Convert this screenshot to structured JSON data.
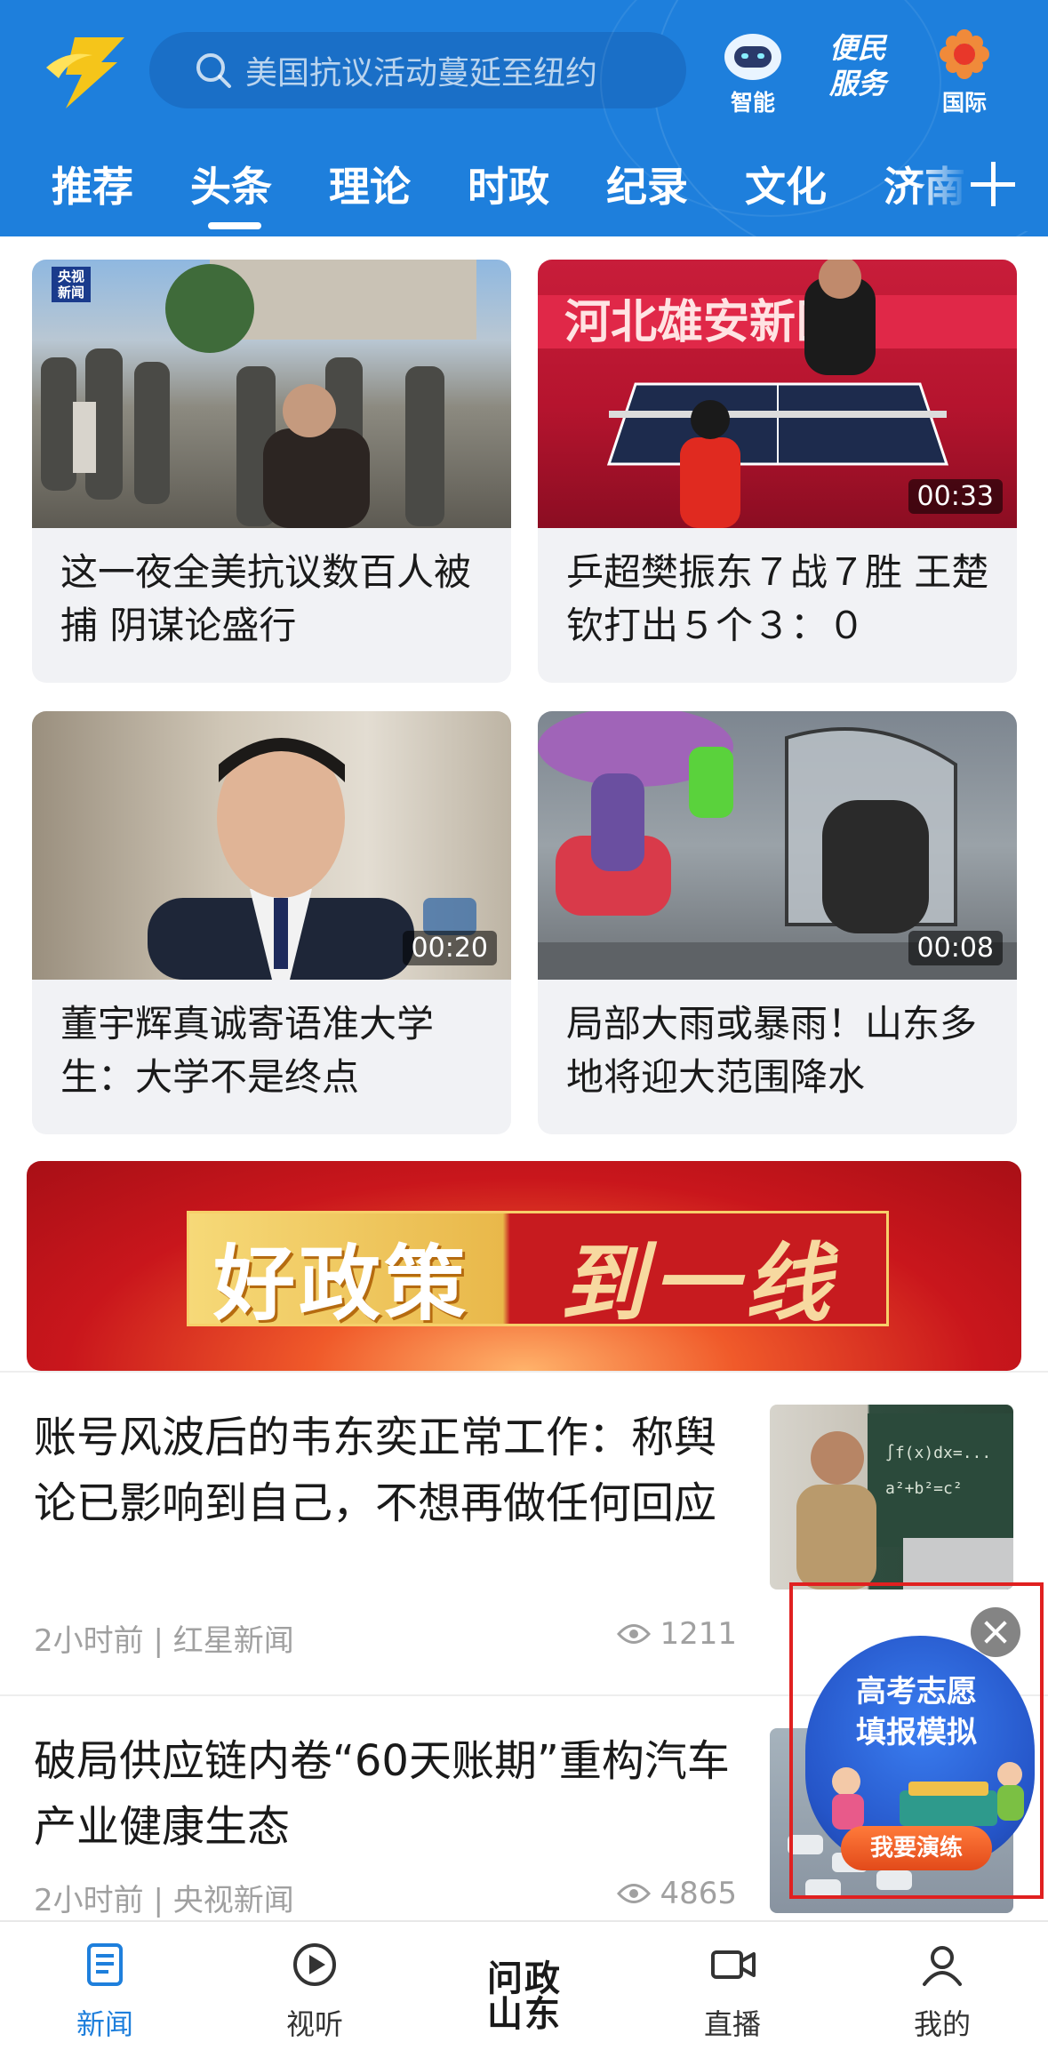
{
  "header": {
    "search_placeholder": "美国抗议活动蔓延至纽约",
    "icons": [
      {
        "name": "smart-icon",
        "label": "智能"
      },
      {
        "name": "service-icon",
        "label": "便民服务"
      },
      {
        "name": "intl-icon",
        "label": "国际"
      }
    ],
    "service_logo_text": "便民服务"
  },
  "tabs": [
    "推荐",
    "头条",
    "理论",
    "时政",
    "纪录",
    "文化",
    "济南"
  ],
  "active_tab": "头条",
  "cards": [
    {
      "title": "这一夜全美抗议数百人被捕 阴谋论盛行",
      "badge": "央视新闻",
      "duration": ""
    },
    {
      "title": "乒超樊振东７战７胜 王楚钦打出５个３：０",
      "badge": "",
      "duration": "00:33"
    },
    {
      "title": "董宇辉真诚寄语准大学生：大学不是终点",
      "badge": "",
      "duration": "00:20"
    },
    {
      "title": "局部大雨或暴雨！山东多地将迎大范围降水",
      "badge": "",
      "duration": "00:08"
    }
  ],
  "banner": {
    "part1": "好政策",
    "part2": "到一线"
  },
  "news": [
    {
      "title": "账号风波后的韦东奕正常工作：称舆论已影响到自己，不想再做任何回应",
      "meta": "2小时前 | 红星新闻",
      "views": "1211"
    },
    {
      "title": "破局供应链内卷“60天账期”重构汽车产业健康生态",
      "meta": "2小时前 | 央视新闻",
      "views": "4865"
    }
  ],
  "ad": {
    "line1": "高考志愿",
    "line2": "填报模拟",
    "button": "我要演练"
  },
  "bottom_nav": [
    {
      "label": "新闻",
      "icon": "news-icon",
      "active": true
    },
    {
      "label": "视听",
      "icon": "play-icon",
      "active": false
    },
    {
      "label": "问政山东",
      "icon": "wenzheng-logo",
      "active": false
    },
    {
      "label": "直播",
      "icon": "live-icon",
      "active": false
    },
    {
      "label": "我的",
      "icon": "profile-icon",
      "active": false
    }
  ],
  "colors": {
    "brand_blue": "#1e7fdc",
    "ad_border": "#e02020"
  }
}
